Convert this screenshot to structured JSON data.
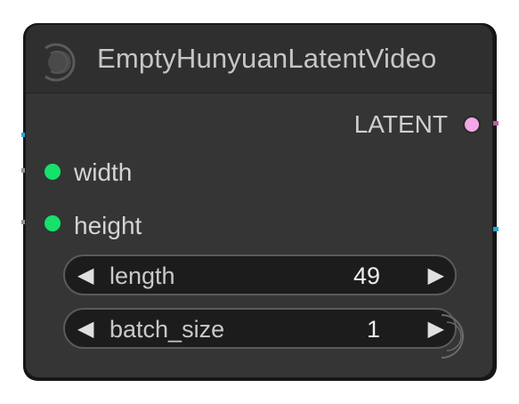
{
  "node": {
    "title": "EmptyHunyuanLatentVideo",
    "logo_icon": "comfy-logo-icon"
  },
  "outputs": [
    {
      "label": "LATENT",
      "color": "#f2a7e6"
    }
  ],
  "inputs": [
    {
      "label": "width",
      "color": "#14e26a"
    },
    {
      "label": "height",
      "color": "#14e26a"
    }
  ],
  "widgets": [
    {
      "label": "length",
      "value": "49"
    },
    {
      "label": "batch_size",
      "value": "1"
    }
  ],
  "arrows": {
    "left": "◀",
    "right": "▶"
  },
  "wire_colors": {
    "cyan": "#2aa8d8",
    "gray": "#8a9a8e",
    "pink": "#c55aa6"
  }
}
